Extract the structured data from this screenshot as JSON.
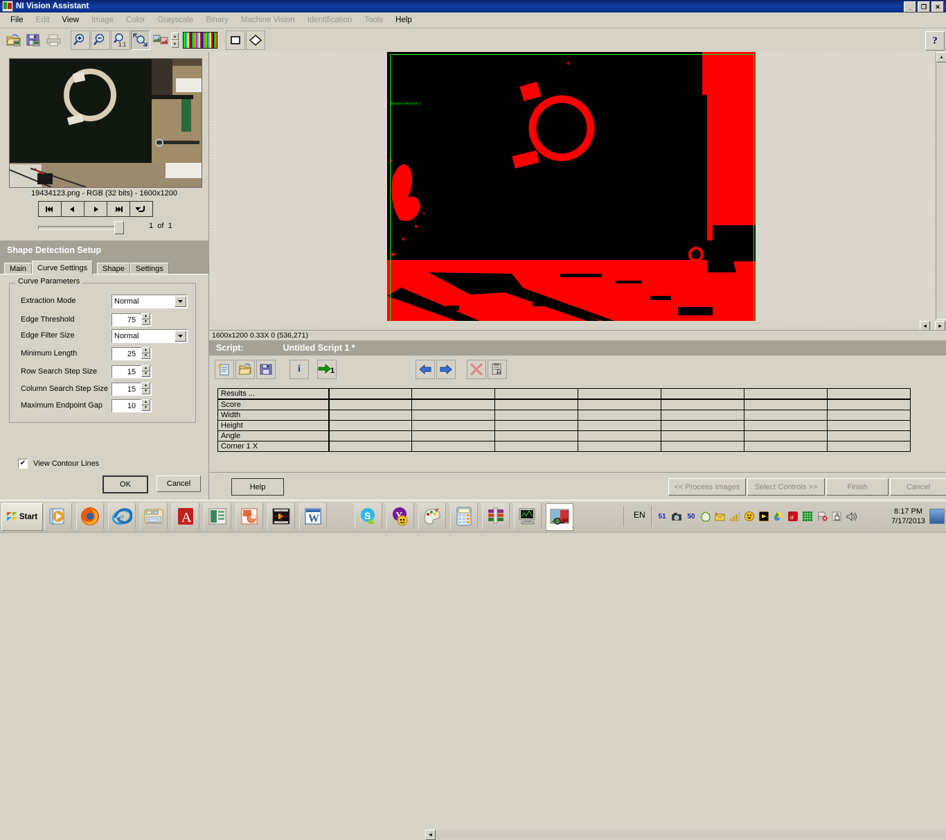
{
  "window": {
    "title": "NI Vision Assistant",
    "icon": "app-icon",
    "minimize": "_",
    "restore": "❐",
    "close": "✕"
  },
  "menubar": {
    "items": [
      {
        "label": "File",
        "enabled": true
      },
      {
        "label": "Edit",
        "enabled": false
      },
      {
        "label": "View",
        "enabled": true
      },
      {
        "label": "Image",
        "enabled": false
      },
      {
        "label": "Color",
        "enabled": false
      },
      {
        "label": "Grayscale",
        "enabled": false
      },
      {
        "label": "Binary",
        "enabled": false
      },
      {
        "label": "Machine Vision",
        "enabled": false
      },
      {
        "label": "Identification",
        "enabled": false
      },
      {
        "label": "Tools",
        "enabled": false
      },
      {
        "label": "Help",
        "enabled": true
      }
    ]
  },
  "toolbar": {
    "buttons": [
      {
        "name": "open-image-icon"
      },
      {
        "name": "save-image-icon"
      },
      {
        "name": "print-icon"
      },
      {
        "name": "zoom-in-icon"
      },
      {
        "name": "zoom-out-icon"
      },
      {
        "name": "zoom-one-to-one-icon",
        "label": "1:1"
      },
      {
        "name": "zoom-to-fit-icon",
        "selected": true
      },
      {
        "name": "image-pair-icon"
      },
      {
        "name": "color-palette-bar"
      },
      {
        "name": "rectangle-roi-icon"
      },
      {
        "name": "rotated-rectangle-roi-icon"
      }
    ],
    "help_label": "?"
  },
  "left_panel": {
    "image_info": "19434123.png - RGB (32 bits) - 1600x1200",
    "nav_buttons": [
      {
        "name": "first-image-button",
        "glyph": "◀◀|"
      },
      {
        "name": "previous-image-button",
        "glyph": "◀"
      },
      {
        "name": "next-image-button",
        "glyph": "▶"
      },
      {
        "name": "last-image-button",
        "glyph": "|▶▶"
      },
      {
        "name": "loop-images-button",
        "glyph": "↵"
      }
    ],
    "page_current": "1",
    "page_of": "of",
    "page_total": "1",
    "setup_title": "Shape Detection Setup",
    "tabs": [
      {
        "label": "Main",
        "active": false
      },
      {
        "label": "Curve Settings",
        "active": true
      },
      {
        "label": "Shape",
        "active": false
      },
      {
        "label": "Settings",
        "active": false
      }
    ],
    "group_title": "Curve Parameters",
    "parameters": [
      {
        "label": "Extraction Mode",
        "type": "combo",
        "value": "Normal"
      },
      {
        "label": "Edge Threshold",
        "type": "number",
        "value": "75"
      },
      {
        "label": "Edge Filter Size",
        "type": "combo",
        "value": "Normal"
      },
      {
        "label": "Minimum Length",
        "type": "number",
        "value": "25"
      },
      {
        "label": "Row Search Step Size",
        "type": "number",
        "value": "15"
      },
      {
        "label": "Column Search Step Size",
        "type": "number",
        "value": "15"
      },
      {
        "label": "Maximum Endpoint Gap",
        "type": "number",
        "value": "10"
      }
    ],
    "view_contour_label": "View Contour Lines",
    "view_contour_checked": "✔",
    "ok_label": "OK",
    "cancel_label": "Cancel"
  },
  "image_view": {
    "roi_label": "Shape Detection 1",
    "roi_color": "#00ff00",
    "binary_on_color": "#ff0000",
    "binary_off_color": "#000000"
  },
  "status_bar": {
    "text": "1600x1200 0.33X 0   (536,271)"
  },
  "script": {
    "label": "Script:",
    "name": "Untitled Script 1 *",
    "tools": [
      {
        "name": "new-script-icon"
      },
      {
        "name": "open-script-icon"
      },
      {
        "name": "save-script-icon"
      },
      {
        "name": "script-info-icon",
        "glyph": "i"
      },
      {
        "name": "run-once-icon",
        "label": "1"
      },
      {
        "name": "step-back-icon"
      },
      {
        "name": "step-forward-icon"
      },
      {
        "name": "delete-step-icon",
        "glyph": "✕"
      },
      {
        "name": "paste-step-icon"
      }
    ]
  },
  "results": {
    "header_label": "Results ...",
    "rows": [
      "Score",
      "Width",
      "Height",
      "Angle",
      "Corner 1 X"
    ],
    "column_count": 7,
    "side_buttons": [
      {
        "name": "measurement-table-icon"
      },
      {
        "name": "save-measurements-icon"
      }
    ]
  },
  "bottom_bar": {
    "help_label": "Help",
    "buttons": [
      {
        "label": "<< Process Images",
        "enabled": false
      },
      {
        "label": "Select Controls >>",
        "enabled": false
      },
      {
        "label": "Finish",
        "enabled": false
      },
      {
        "label": "Cancel",
        "enabled": false
      }
    ]
  },
  "taskbar": {
    "start_label": "Start",
    "apps": [
      {
        "name": "taskbar-media-player"
      },
      {
        "name": "taskbar-firefox"
      },
      {
        "name": "taskbar-internet-explorer"
      },
      {
        "name": "taskbar-file-explorer"
      },
      {
        "name": "taskbar-adobe-reader"
      },
      {
        "name": "taskbar-excel"
      },
      {
        "name": "taskbar-powerpoint"
      },
      {
        "name": "taskbar-labview"
      },
      {
        "name": "taskbar-word"
      },
      {
        "name": "taskbar-skype"
      },
      {
        "name": "taskbar-yahoo-messenger"
      },
      {
        "name": "taskbar-paint"
      },
      {
        "name": "taskbar-calculator"
      },
      {
        "name": "taskbar-winrar"
      },
      {
        "name": "taskbar-measurement-studio"
      },
      {
        "name": "taskbar-vision-assistant",
        "active": true
      }
    ],
    "language": "EN",
    "tray": [
      {
        "name": "tray-51-indicator",
        "glyph": "51"
      },
      {
        "name": "tray-camera-icon",
        "glyph": "📷"
      },
      {
        "name": "tray-50-indicator",
        "glyph": "50"
      },
      {
        "name": "tray-leaf-icon",
        "glyph": "◯"
      },
      {
        "name": "tray-mail-icon",
        "glyph": "✉"
      },
      {
        "name": "tray-signal-icon",
        "glyph": "▁▃▅"
      },
      {
        "name": "tray-smiley-icon",
        "glyph": "☺"
      },
      {
        "name": "tray-labview-icon",
        "glyph": "▶"
      },
      {
        "name": "tray-google-drive-icon",
        "glyph": "▲"
      },
      {
        "name": "tray-avira-icon",
        "glyph": "A"
      },
      {
        "name": "tray-grid-icon",
        "glyph": "▦"
      },
      {
        "name": "tray-network-error-icon",
        "glyph": "⚑"
      },
      {
        "name": "tray-hand-icon",
        "glyph": "✋"
      },
      {
        "name": "tray-volume-icon",
        "glyph": "🔊"
      }
    ],
    "time": "8:17 PM",
    "date": "7/17/2013"
  }
}
